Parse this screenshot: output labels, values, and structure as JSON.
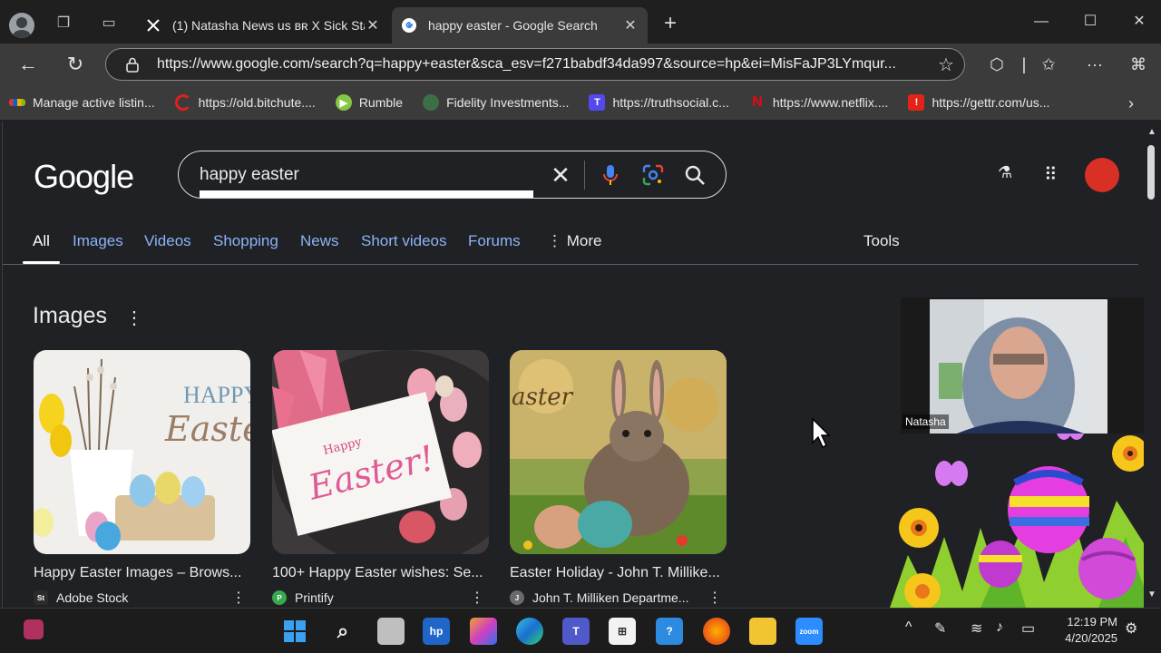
{
  "browser": {
    "tabs": [
      {
        "title": "(1) Natasha News us ʙʀ X Sick Sta",
        "favicon": "x-logo-icon",
        "active": false
      },
      {
        "title": "happy easter - Google Search",
        "favicon": "google-g-icon",
        "active": true
      }
    ],
    "url": "https://www.google.com/search?q=happy+easter&sca_esv=f271babdf34da997&source=hp&ei=MisFaJP3LYmqur...",
    "bookmarks": [
      {
        "label": "Manage active listin...",
        "icon": "ebay-icon"
      },
      {
        "label": "https://old.bitchute....",
        "icon": "bitchute-icon"
      },
      {
        "label": "Rumble",
        "icon": "rumble-icon"
      },
      {
        "label": "Fidelity Investments...",
        "icon": "fidelity-icon"
      },
      {
        "label": "https://truthsocial.c...",
        "icon": "truthsocial-icon"
      },
      {
        "label": "https://www.netflix....",
        "icon": "netflix-icon"
      },
      {
        "label": "https://gettr.com/us...",
        "icon": "gettr-icon"
      }
    ]
  },
  "google": {
    "logo": "Google",
    "query": "happy easter",
    "nav": [
      {
        "label": "All",
        "active": true
      },
      {
        "label": "Images"
      },
      {
        "label": "Videos"
      },
      {
        "label": "Shopping"
      },
      {
        "label": "News"
      },
      {
        "label": "Short videos"
      },
      {
        "label": "Forums"
      }
    ],
    "more_label": "More",
    "tools_label": "Tools",
    "images_section": {
      "title": "Images",
      "results": [
        {
          "caption": "Happy Easter Images – Brows...",
          "source": "Adobe Stock",
          "source_badge": "St"
        },
        {
          "caption": "100+ Happy Easter wishes: Se...",
          "source": "Printify",
          "source_badge": "P"
        },
        {
          "caption": "Easter Holiday - John T. Millike...",
          "source": "John T. Milliken Departme...",
          "source_badge": "J"
        }
      ]
    },
    "image_text": {
      "card1_line1": "HAPPY",
      "card1_line2": "Easte",
      "card2_line1": "Happy",
      "card2_line2": "Easter!",
      "card3_word": "aster"
    }
  },
  "video_overlay": {
    "participant_name": "Natasha"
  },
  "taskbar": {
    "time": "12:19 PM",
    "date": "4/20/2025"
  }
}
